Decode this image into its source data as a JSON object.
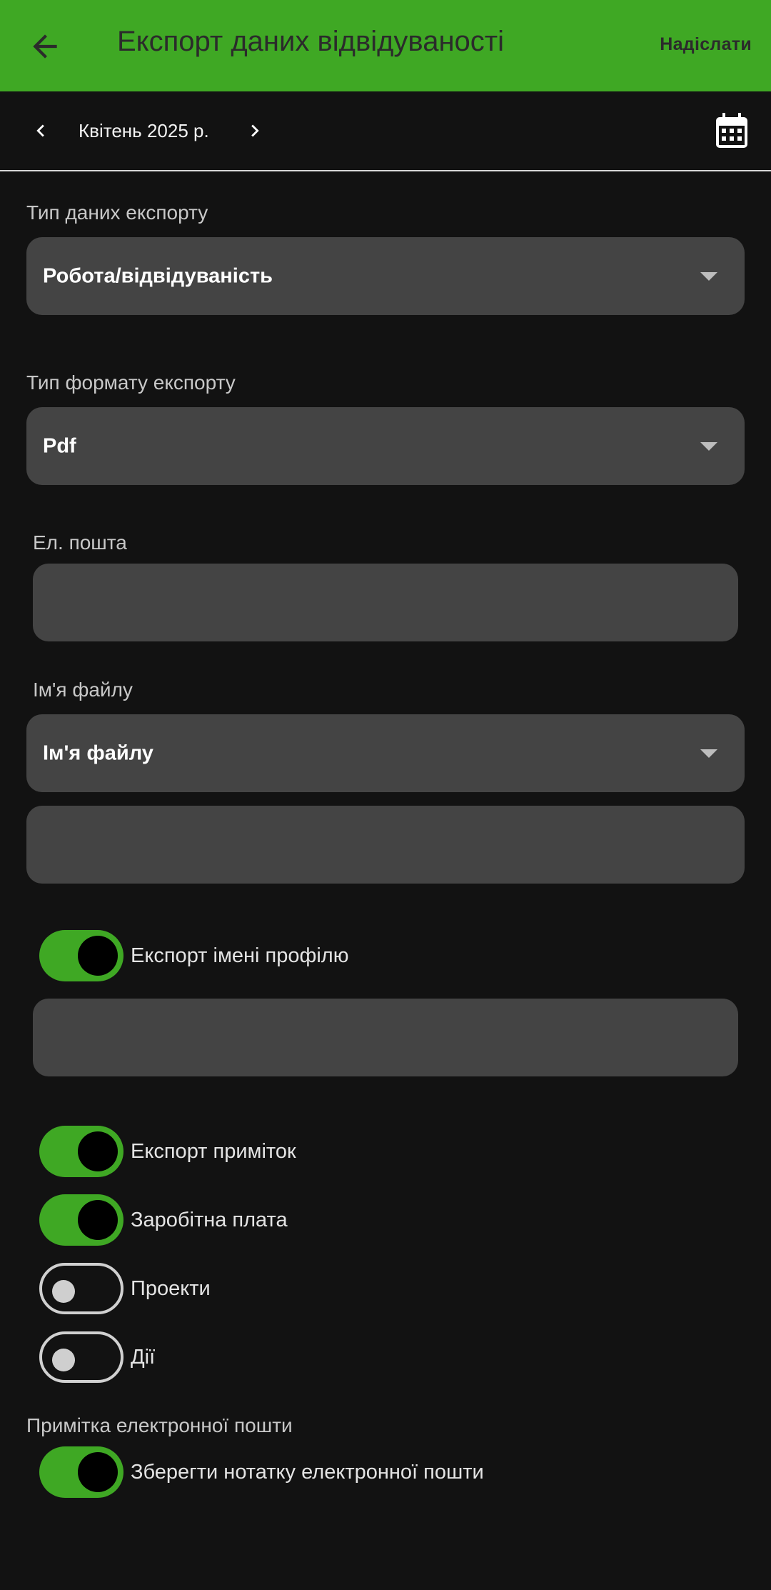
{
  "appbar": {
    "title": "Експорт даних відвідуваності",
    "send_label": "Надіслати",
    "bg_color": "#3fa824"
  },
  "month_nav": {
    "label": "Квітень 2025 р."
  },
  "form": {
    "export_data_type": {
      "label": "Тип даних експорту",
      "value": "Робота/відвідуваність"
    },
    "export_format_type": {
      "label": "Тип формату експорту",
      "value": "Pdf"
    },
    "email": {
      "label": "Ел. пошта",
      "value": ""
    },
    "file_name": {
      "label": "Ім'я файлу",
      "select_value": "Ім'я файлу",
      "text_value": ""
    },
    "profile_name_value": ""
  },
  "toggles": {
    "export_profile_name": {
      "label": "Експорт імені профілю",
      "on": true
    },
    "export_notes": {
      "label": "Експорт приміток",
      "on": true
    },
    "salary": {
      "label": "Заробітна плата",
      "on": true
    },
    "projects": {
      "label": "Проекти",
      "on": false
    },
    "actions": {
      "label": "Дії",
      "on": false
    },
    "save_email_note": {
      "label": "Зберегти нотатку електронної пошти",
      "on": true
    }
  },
  "email_note_section": {
    "label": "Примітка електронної пошти"
  },
  "colors": {
    "accent": "#3fa824",
    "background": "#121212",
    "field": "#444444"
  }
}
